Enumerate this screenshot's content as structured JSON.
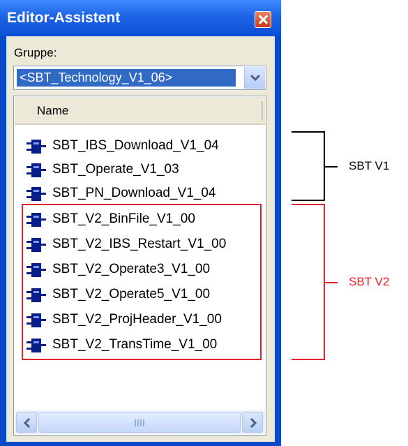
{
  "window": {
    "title": "Editor-Assistent",
    "close_icon": "close-icon"
  },
  "group": {
    "label": "Gruppe:",
    "selected": "<SBT_Technology_V1_06>",
    "dropdown_icon": "chevron-down-icon"
  },
  "list": {
    "column_header": "Name",
    "item_icon": "function-block-icon",
    "items": [
      "SBT_IBS_Download_V1_04",
      "SBT_Operate_V1_03",
      "SBT_PN_Download_V1_04",
      "SBT_V2_BinFile_V1_00",
      "SBT_V2_IBS_Restart_V1_00",
      "SBT_V2_Operate3_V1_00",
      "SBT_V2_Operate5_V1_00",
      "SBT_V2_ProjHeader_V1_00",
      "SBT_V2_TransTime_V1_00"
    ]
  },
  "annotations": {
    "v1_label": "SBT V1",
    "v2_label": "SBT V2",
    "v1_color": "#000000",
    "v2_color": "#e3232b"
  },
  "colors": {
    "titlebar": "#0b4fd6",
    "selection": "#316ac5",
    "client": "#ece9d8"
  }
}
